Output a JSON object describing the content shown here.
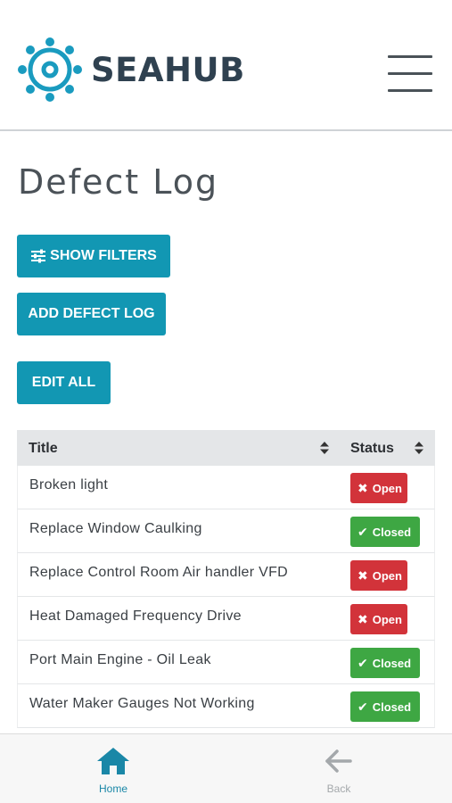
{
  "header": {
    "brand": "SEAHUB",
    "logo_icon": "ship-wheel-icon",
    "menu_icon": "hamburger-menu-icon"
  },
  "page": {
    "title": "Defect Log"
  },
  "actions": {
    "show_filters": "SHOW FILTERS",
    "show_filters_icon": "sliders-icon",
    "add_defect_log": "ADD DEFECT LOG",
    "edit_all": "EDIT ALL"
  },
  "table": {
    "columns": [
      "Title",
      "Status"
    ],
    "rows": [
      {
        "title": "Broken light",
        "status": "Open"
      },
      {
        "title": "Replace Window Caulking",
        "status": "Closed"
      },
      {
        "title": "Replace Control Room Air handler VFD",
        "status": "Open"
      },
      {
        "title": "Heat Damaged Frequency Drive",
        "status": "Open"
      },
      {
        "title": "Port Main Engine - Oil Leak",
        "status": "Closed"
      },
      {
        "title": "Water Maker Gauges Not Working",
        "status": "Closed"
      }
    ]
  },
  "bottom_nav": {
    "home": "Home",
    "back": "Back"
  },
  "colors": {
    "primary": "#1297b3",
    "open": "#d2333a",
    "closed": "#3ea743",
    "brand_text": "#2f4150"
  }
}
